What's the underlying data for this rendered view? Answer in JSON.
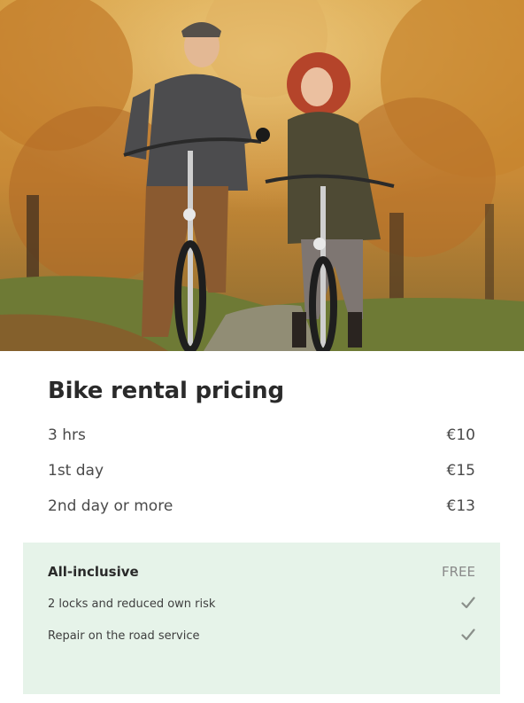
{
  "hero": {
    "image_alt": "Two people riding bicycles in an autumn park"
  },
  "pricing": {
    "title": "Bike rental pricing",
    "rows": [
      {
        "label": "3 hrs",
        "price": "€10"
      },
      {
        "label": "1st day",
        "price": "€15"
      },
      {
        "label": "2nd day or more",
        "price": "€13"
      }
    ]
  },
  "all_inclusive": {
    "title": "All-inclusive",
    "price": "FREE",
    "items": [
      {
        "label": "2 locks and reduced own risk",
        "icon": "check-icon"
      },
      {
        "label": "Repair on the road service",
        "icon": "check-icon"
      }
    ]
  },
  "colors": {
    "panel_bg": "#e6f3e9",
    "text_dark": "#2a2a2a",
    "text_muted": "#8a8a8a"
  }
}
